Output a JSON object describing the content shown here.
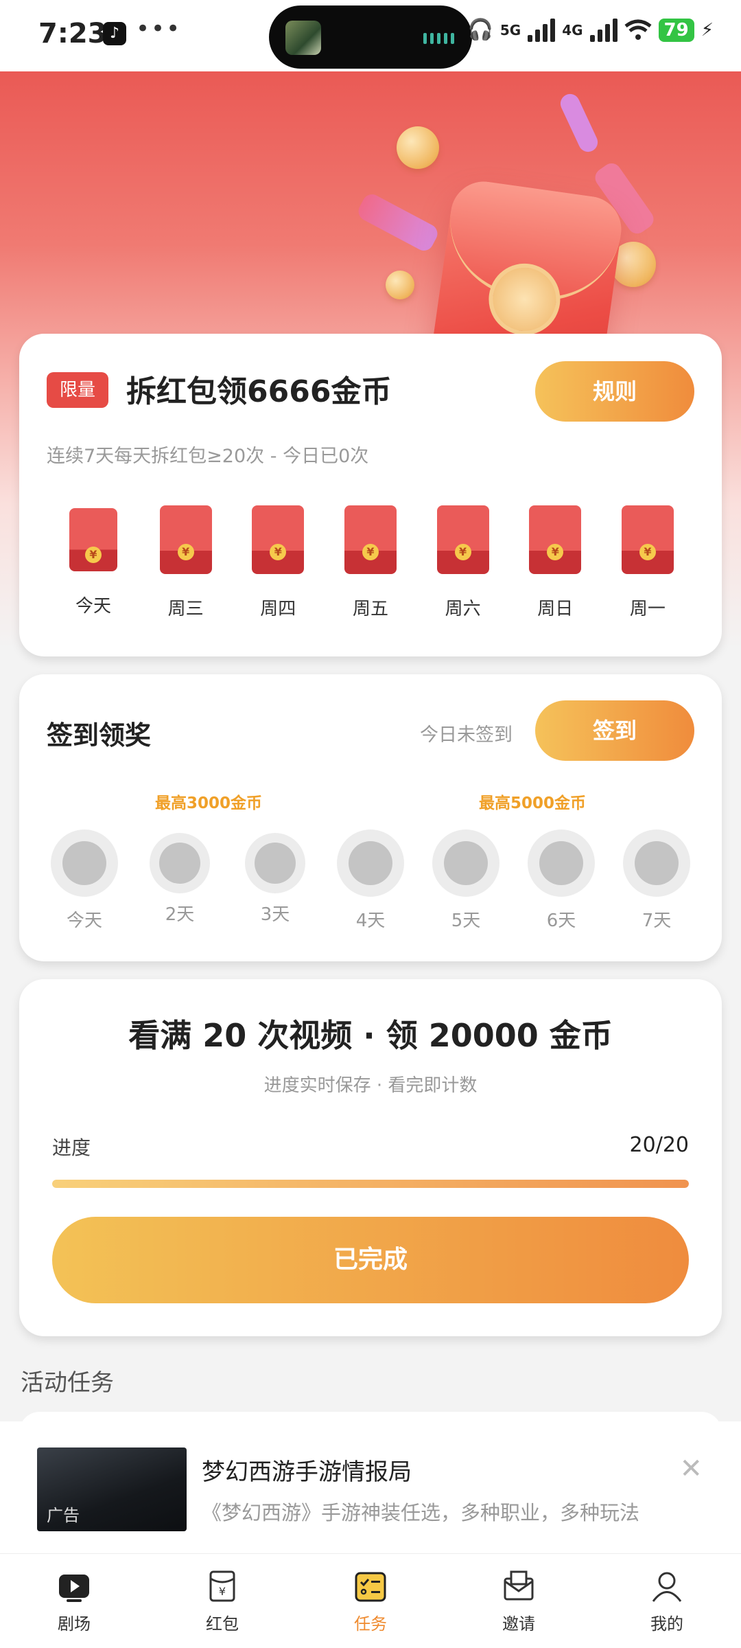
{
  "status": {
    "time": "7:23",
    "app_badge": "♪",
    "more": "•••",
    "net1": "5G",
    "net2": "4G",
    "battery": "79"
  },
  "card1": {
    "tag": "限量",
    "title": "拆红包领6666金币",
    "rule_label": "规则",
    "subtitle": "连续7天每天拆红包≥20次 - 今日已0次",
    "packets": [
      {
        "label": "今天",
        "icon": "¥"
      },
      {
        "label": "周三",
        "icon": "¥"
      },
      {
        "label": "周四",
        "icon": "¥"
      },
      {
        "label": "周五",
        "icon": "¥"
      },
      {
        "label": "周六",
        "icon": "¥"
      },
      {
        "label": "周日",
        "icon": "¥"
      },
      {
        "label": "周一",
        "icon": "¥"
      }
    ]
  },
  "checkin": {
    "title": "签到领奖",
    "status": "今日未签到",
    "button": "签到",
    "hint_left": "最高3000金币",
    "hint_right": "最高5000金币",
    "days": [
      "今天",
      "2天",
      "3天",
      "4天",
      "5天",
      "6天",
      "7天"
    ]
  },
  "video_task": {
    "title": "看满 20 次视频 · 领 20000 金币",
    "subtitle": "进度实时保存 · 看完即计数",
    "progress_label": "进度",
    "progress_text": "20/20",
    "progress_fraction": 1.0,
    "button": "已完成"
  },
  "section_title": "活动任务",
  "ad": {
    "badge": "广告",
    "title": "梦幻西游手游情报局",
    "desc": "《梦幻西游》手游神装任选，多种职业，多种玩法",
    "close": "✕"
  },
  "tabs": [
    {
      "label": "剧场",
      "icon": "play-icon",
      "active": false
    },
    {
      "label": "红包",
      "icon": "red-packet-icon",
      "active": false
    },
    {
      "label": "任务",
      "icon": "task-list-icon",
      "active": true
    },
    {
      "label": "邀请",
      "icon": "mail-icon",
      "active": false
    },
    {
      "label": "我的",
      "icon": "profile-icon",
      "active": false
    }
  ],
  "colors": {
    "accent": "#ef8a2e",
    "red": "#e64b45",
    "gold": "#f5c25a"
  }
}
